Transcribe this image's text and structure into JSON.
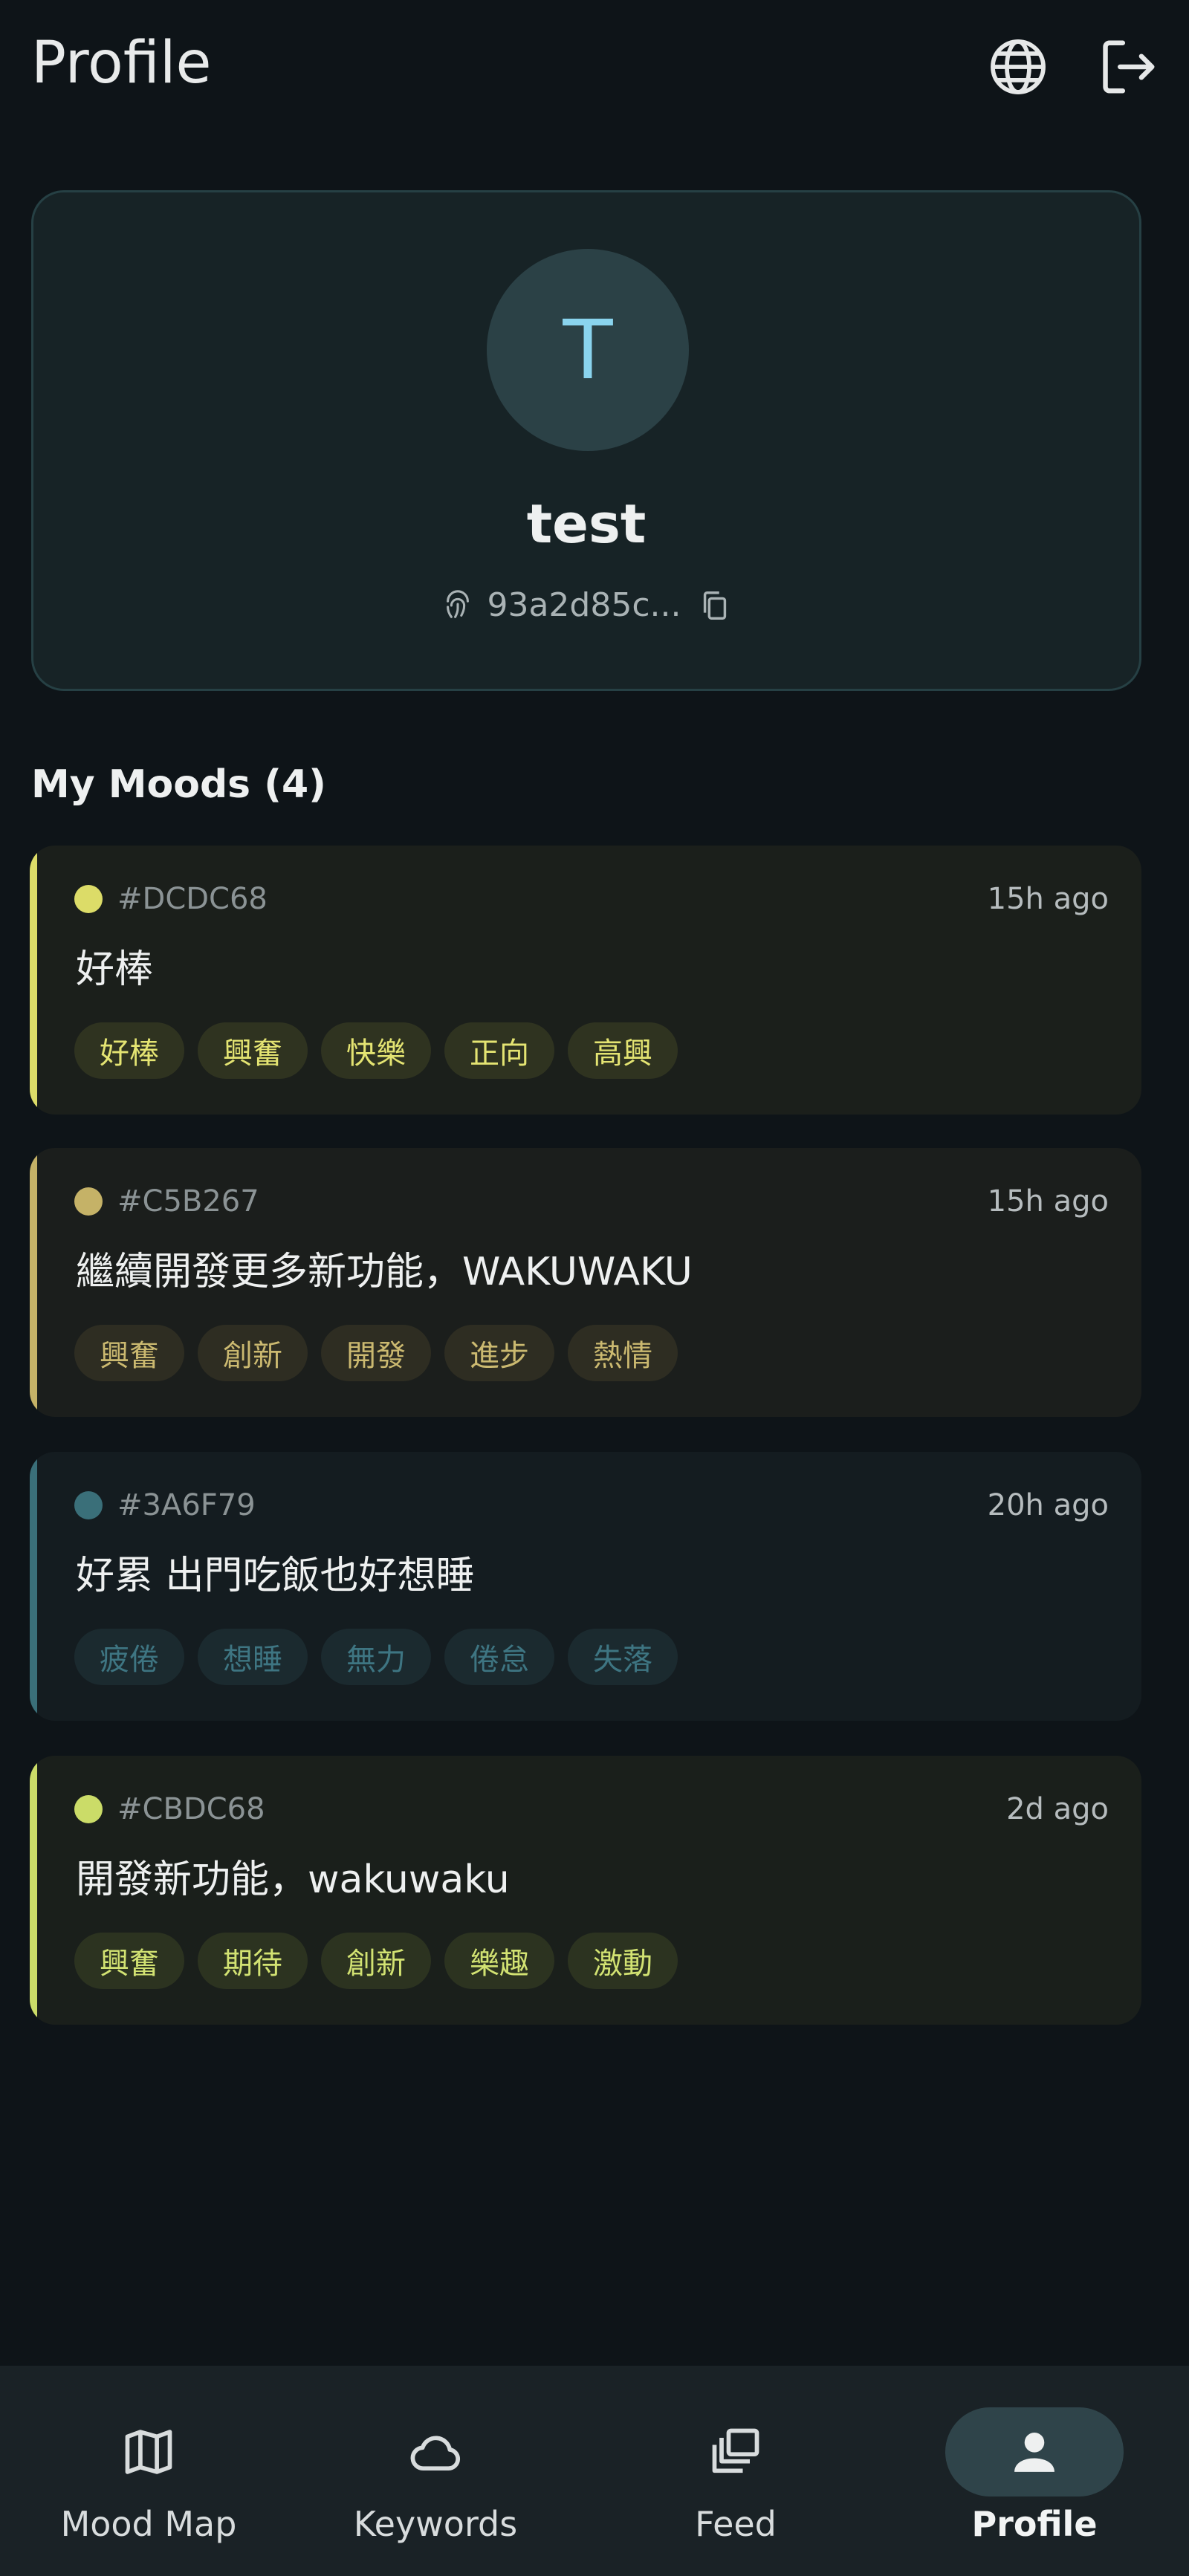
{
  "header": {
    "title": "Profile",
    "language_icon": "globe-icon",
    "logout_icon": "logout-icon"
  },
  "profile": {
    "avatar_initial": "T",
    "username": "test",
    "user_id": "93a2d85c...",
    "id_icon": "fingerprint-icon",
    "copy_icon": "copy-icon"
  },
  "moods_section": {
    "title": "My Moods (4)"
  },
  "moods": [
    {
      "color": "#DCDC68",
      "hex_label": "#DCDC68",
      "time": "15h ago",
      "text": "好棒",
      "tags": [
        "好棒",
        "興奮",
        "快樂",
        "正向",
        "高興"
      ],
      "card_bg": "#1b1f1b",
      "tag_bg": "#2f3320",
      "tag_fg": "#e4e472"
    },
    {
      "color": "#C5B267",
      "hex_label": "#C5B267",
      "time": "15h ago",
      "text": "繼續開發更多新功能，WAKUWAKU",
      "tags": [
        "興奮",
        "創新",
        "開發",
        "進步",
        "熱情"
      ],
      "card_bg": "#1b1e1c",
      "tag_bg": "#2e2d22",
      "tag_fg": "#cbb970"
    },
    {
      "color": "#3A6F79",
      "hex_label": "#3A6F79",
      "time": "20h ago",
      "text": "好累 出門吃飯也好想睡",
      "tags": [
        "疲倦",
        "想睡",
        "無力",
        "倦怠",
        "失落"
      ],
      "card_bg": "#141c20",
      "tag_bg": "#1b2a2f",
      "tag_fg": "#3e7582"
    },
    {
      "color": "#CBDC68",
      "hex_label": "#CBDC68",
      "time": "2d ago",
      "text": "開發新功能，wakuwaku",
      "tags": [
        "興奮",
        "期待",
        "創新",
        "樂趣",
        "激動"
      ],
      "card_bg": "#1a1f1b",
      "tag_bg": "#2c3320",
      "tag_fg": "#d2e272"
    }
  ],
  "bottom_nav": {
    "items": [
      {
        "label": "Mood Map",
        "icon": "map-icon",
        "active": false
      },
      {
        "label": "Keywords",
        "icon": "cloud-icon",
        "active": false
      },
      {
        "label": "Feed",
        "icon": "stack-icon",
        "active": false
      },
      {
        "label": "Profile",
        "icon": "person-icon",
        "active": true
      }
    ]
  }
}
